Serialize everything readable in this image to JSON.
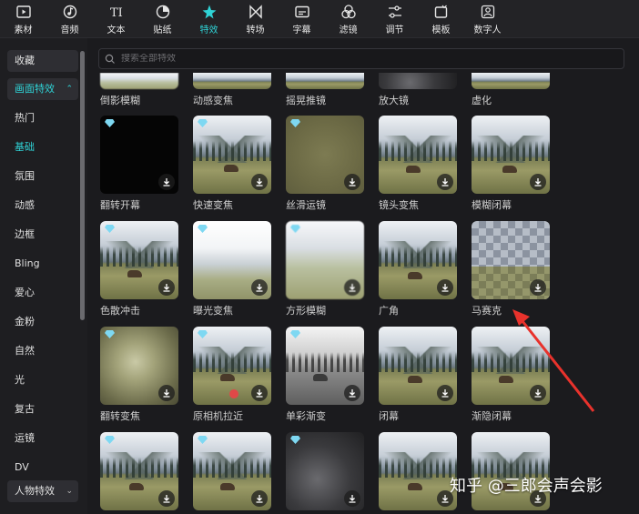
{
  "toolbar": {
    "tabs": [
      {
        "label": "素材",
        "icon": "media-icon"
      },
      {
        "label": "音频",
        "icon": "audio-icon"
      },
      {
        "label": "文本",
        "icon": "text-icon"
      },
      {
        "label": "贴纸",
        "icon": "sticker-icon"
      },
      {
        "label": "特效",
        "icon": "effects-icon",
        "active": true
      },
      {
        "label": "转场",
        "icon": "transition-icon"
      },
      {
        "label": "字幕",
        "icon": "subtitle-icon"
      },
      {
        "label": "滤镜",
        "icon": "filter-icon"
      },
      {
        "label": "调节",
        "icon": "adjust-icon"
      },
      {
        "label": "模板",
        "icon": "template-icon"
      },
      {
        "label": "数字人",
        "icon": "digital-human-icon"
      }
    ]
  },
  "sidebar": {
    "favorites": "收藏",
    "section": "画面特效",
    "items": [
      "热门",
      "基础",
      "氛围",
      "动感",
      "边框",
      "Bling",
      "爱心",
      "金粉",
      "自然",
      "光",
      "复古",
      "运镜",
      "DV"
    ],
    "active_item": "基础",
    "bottom_section": "人物特效"
  },
  "search": {
    "placeholder": "搜索全部特效"
  },
  "effects": {
    "row0": [
      "倒影模糊",
      "动感变焦",
      "摇晃推镜",
      "放大镜",
      "虚化"
    ],
    "row1": [
      "翻转开幕",
      "快速变焦",
      "丝滑运镜",
      "镜头变焦",
      "模糊闭幕"
    ],
    "row2": [
      "色散冲击",
      "曝光变焦",
      "方形模糊",
      "广角",
      "马赛克"
    ],
    "row3": [
      "翻转变焦",
      "原相机拉近",
      "单彩渐变",
      "闭幕",
      "渐隐闭幕"
    ]
  },
  "watermark": "知乎 @三郎会声会影",
  "colors": {
    "accent": "#2fd3d6",
    "annotation_arrow": "#e8322c"
  }
}
